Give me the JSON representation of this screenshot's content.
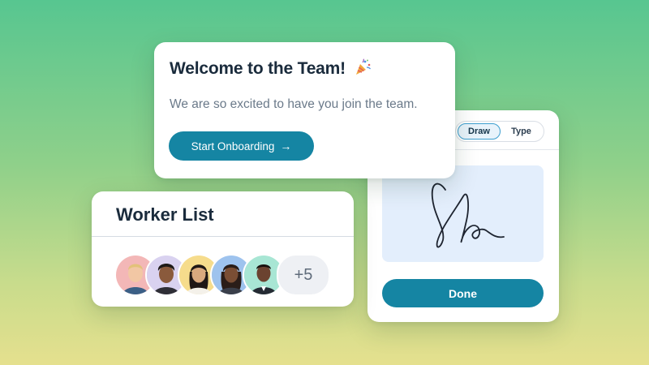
{
  "welcome": {
    "title": "Welcome to the Team!",
    "title_icon": "party-popper-icon",
    "message": "We are so excited to have you join the team.",
    "button_label": "Start Onboarding",
    "button_icon": "arrow-right-icon",
    "button_arrow": "→"
  },
  "signature": {
    "tabs": [
      {
        "label": "Draw",
        "active": true
      },
      {
        "label": "Type",
        "active": false
      }
    ],
    "done_label": "Done",
    "pad_color": "#e3eefc"
  },
  "worker_list": {
    "title": "Worker List",
    "avatars": [
      {
        "bg": "#f3b7b7"
      },
      {
        "bg": "#d9d2f0"
      },
      {
        "bg": "#f6dc8c"
      },
      {
        "bg": "#9ec3ee"
      },
      {
        "bg": "#a8e6d4"
      }
    ],
    "more_count": "+5"
  },
  "colors": {
    "accent": "#1585a3",
    "background_top": "#57c690",
    "background_bottom": "#e5e08e",
    "title_text": "#1a2b3c",
    "body_text": "#6b7a8a"
  }
}
